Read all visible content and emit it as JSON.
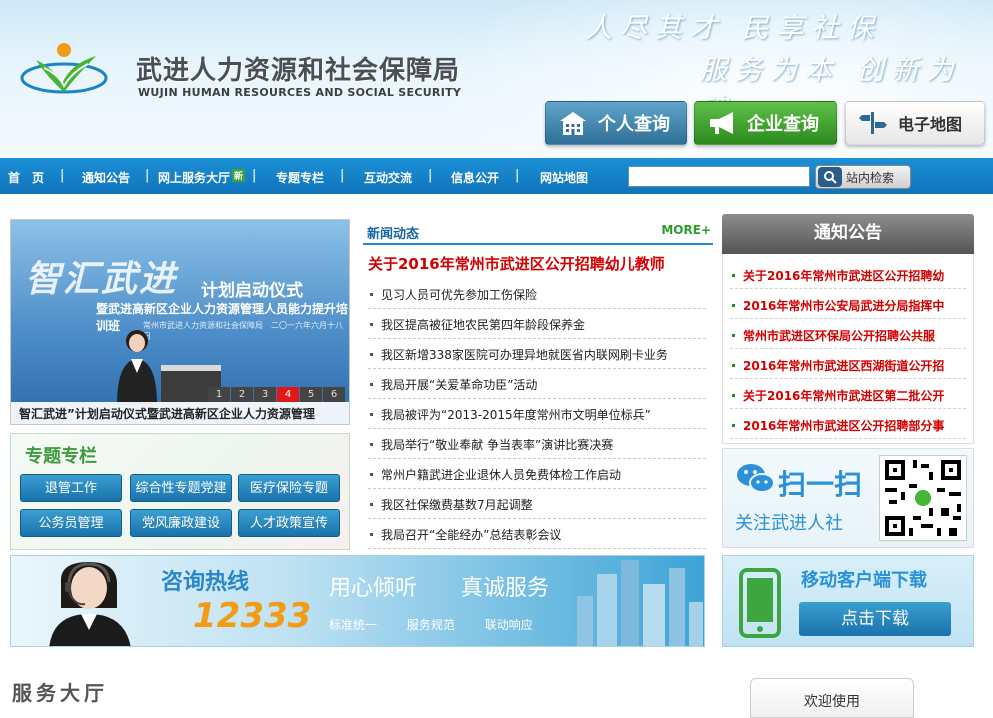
{
  "header": {
    "logo_cn": "武进人力资源和社会保障局",
    "logo_en": "WUJIN HUMAN RESOURCES AND SOCIAL SECURITY",
    "slogan_line1": "人尽其才 民享社保",
    "slogan_line2": "服务为本 创新为魂",
    "buttons": {
      "personal": "个人查询",
      "company": "企业查询",
      "map": "电子地图"
    }
  },
  "nav": {
    "items": [
      "首　页",
      "通知公告",
      "网上服务大厅",
      "专题专栏",
      "互动交流",
      "信息公开",
      "网站地图"
    ],
    "new_badge": "新",
    "search_placeholder": "",
    "search_button": "站内检索"
  },
  "banner": {
    "big_text": "智汇武进",
    "sub1": "计划启动仪式",
    "sub2": "暨武进高新区企业人力资源管理人员能力提升培训班",
    "sub3": "常州市武进人力资源和社会保障局　二〇一六年六月十八日",
    "tabs": [
      "1",
      "2",
      "3",
      "4",
      "5",
      "6"
    ],
    "active_tab": "4",
    "caption": "智汇武进”计划启动仪式暨武进高新区企业人力资源管理"
  },
  "topics": {
    "title": "专题专栏",
    "buttons": [
      "退管工作",
      "综合性专题党建",
      "医疗保险专题",
      "公务员管理",
      "党风廉政建设",
      "人才政策宣传"
    ]
  },
  "news": {
    "title": "新闻动态",
    "more": "MORE+",
    "headline": "关于2016年常州市武进区公开招聘幼儿教师",
    "items": [
      "见习人员可优先参加工伤保险",
      "我区提高被征地农民第四年龄段保养金",
      "我区新增338家医院可办理异地就医省内联网刷卡业务",
      "我局开展“关爱革命功臣”活动",
      "我局被评为“2013-2015年度常州市文明单位标兵”",
      "我局举行“敬业奉献 争当表率”演讲比赛决赛",
      "常州户籍武进企业退休人员免费体检工作启动",
      "我区社保缴费基数7月起调整",
      "我局召开“全能经办”总结表彰会议"
    ]
  },
  "notices": {
    "title": "通知公告",
    "items": [
      "关于2016年常州市武进区公开招聘幼",
      "2016年常州市公安局武进分局指挥中",
      "常州市武进区环保局公开招聘公共服",
      "2016年常州市武进区西湖街道公开招",
      "关于2016年常州市武进区第二批公开",
      "2016年常州市武进区公开招聘部分事"
    ]
  },
  "wechat": {
    "scan": "扫一扫",
    "follow": "关注武进人社"
  },
  "hotline": {
    "label": "咨询热线",
    "number": "12333",
    "slogan1": "用心倾听",
    "slogan2": "真诚服务",
    "tags": [
      "标准统一",
      "服务规范",
      "联动响应"
    ]
  },
  "mobile": {
    "title": "移动客户端下载",
    "download": "点击下载"
  },
  "service_title": "服务大厅",
  "welcome": "欢迎使用",
  "colors": {
    "nav_blue": "#1380c8",
    "headline_red": "#d40000",
    "accent_green": "#3d9a3d",
    "hotline_orange": "#f39b12"
  }
}
